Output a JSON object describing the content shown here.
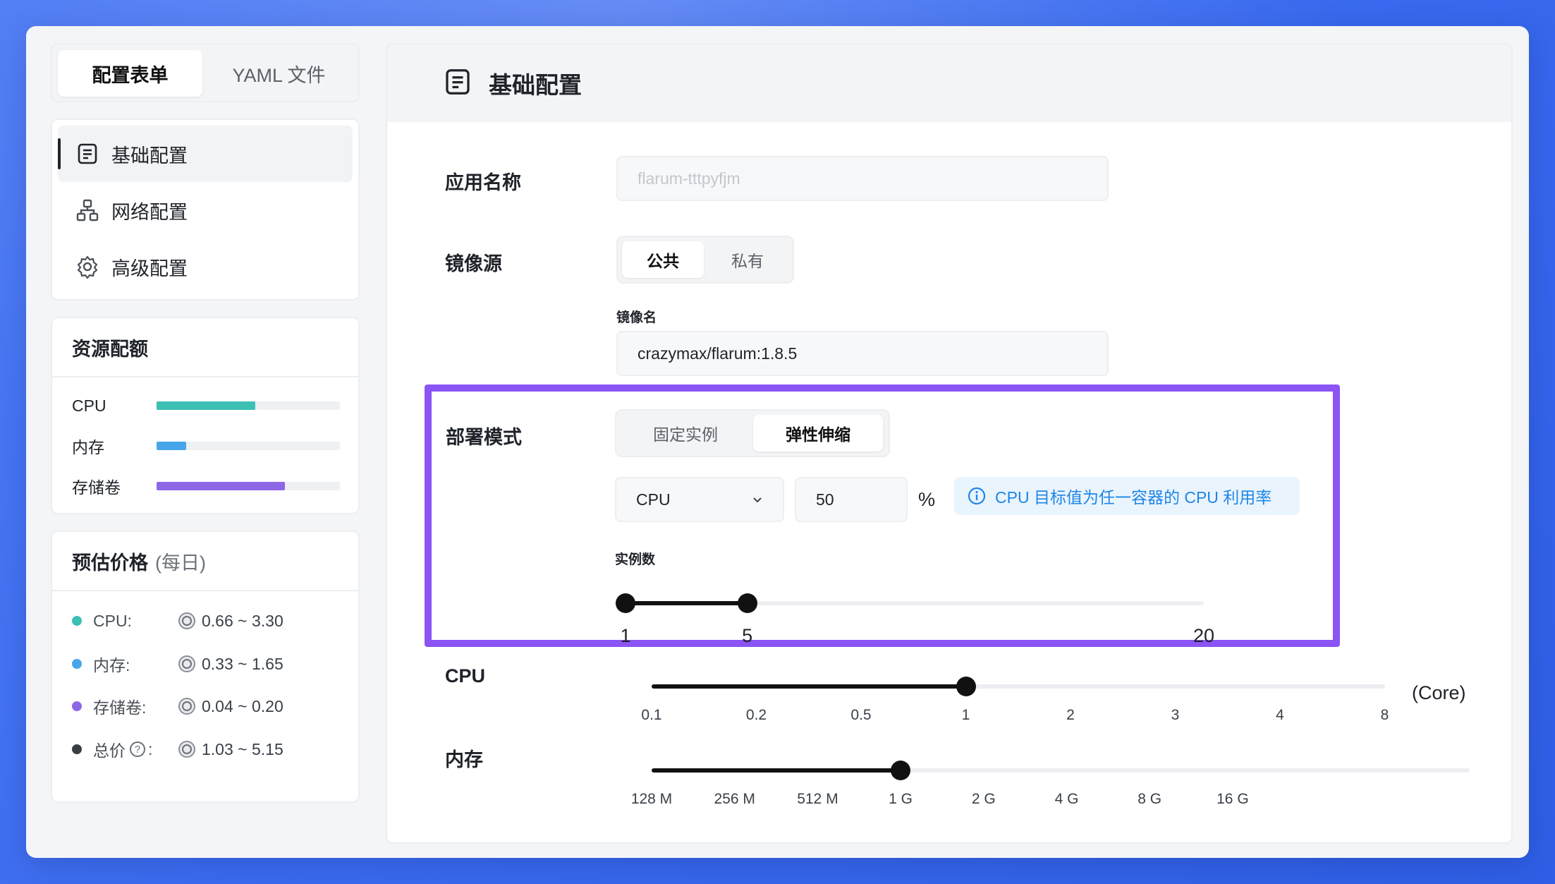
{
  "left": {
    "tabs": [
      {
        "label": "配置表单",
        "active": true
      },
      {
        "label": "YAML 文件",
        "active": false
      }
    ],
    "nav": [
      {
        "label": "基础配置",
        "icon": "document-icon",
        "active": true
      },
      {
        "label": "网络配置",
        "icon": "network-icon",
        "active": false
      },
      {
        "label": "高级配置",
        "icon": "gear-icon",
        "active": false
      }
    ],
    "quota": {
      "title": "资源配额",
      "items": [
        {
          "label": "CPU",
          "fraction": 0.54,
          "color": "#3cc0b4"
        },
        {
          "label": "内存",
          "fraction": 0.16,
          "color": "#47a6ea"
        },
        {
          "label": "存储卷",
          "fraction": 0.7,
          "color": "#8e67e6"
        }
      ]
    },
    "price": {
      "title": "预估价格",
      "subtitle": "(每日)",
      "items": [
        {
          "label": "CPU:",
          "value": "0.66 ~ 3.30",
          "color": "#3cc0b4"
        },
        {
          "label": "内存:",
          "value": "0.33 ~ 1.65",
          "color": "#47a6ea"
        },
        {
          "label": "存储卷:",
          "value": "0.04 ~ 0.20",
          "color": "#8e67e6"
        },
        {
          "label": "总价",
          "value": "1.03 ~ 5.15",
          "color": "#3a3f46",
          "help": "?",
          "colon": ":"
        }
      ]
    }
  },
  "main": {
    "title": "基础配置",
    "app_name": {
      "label": "应用名称",
      "placeholder": "flarum-tttpyfjm"
    },
    "image_source": {
      "label": "镜像源",
      "options": [
        "公共",
        "私有"
      ],
      "selected": "公共",
      "image_name_label": "镜像名",
      "image_name_value": "crazymax/flarum:1.8.5"
    },
    "deploy": {
      "label": "部署模式",
      "options": [
        "固定实例",
        "弹性伸缩"
      ],
      "selected": "弹性伸缩",
      "metric": "CPU",
      "target": "50",
      "percent": "%",
      "tip": "CPU 目标值为任一容器的 CPU 利用率",
      "instances_label": "实例数",
      "instances": {
        "min": "1",
        "value": "5",
        "max": "20"
      }
    },
    "cpu": {
      "label": "CPU",
      "ticks": [
        "0.1",
        "0.2",
        "0.5",
        "1",
        "2",
        "3",
        "4",
        "8"
      ],
      "selected": "1",
      "unit": "(Core)"
    },
    "memory": {
      "label": "内存",
      "ticks": [
        "128 M",
        "256 M",
        "512 M",
        "1 G",
        "2 G",
        "4 G",
        "8 G",
        "16 G"
      ],
      "selected": "1 G"
    }
  },
  "colors": {
    "accent_highlight": "#8b54f5",
    "tip_text": "#1e86e6",
    "tip_bg": "#eaf4fd"
  }
}
